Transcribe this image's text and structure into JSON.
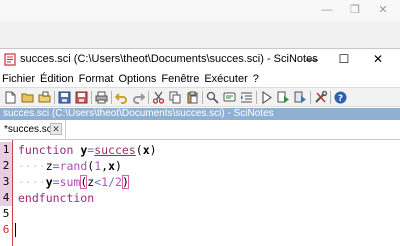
{
  "background_window": {
    "controls": [
      "—",
      "❐",
      "✕"
    ]
  },
  "window": {
    "title": "succes.sci (C:\\Users\\theot\\Documents\\succes.sci) - SciNotes",
    "controls": {
      "minimize": "—",
      "maximize": "☐",
      "close": "✕"
    }
  },
  "menu": [
    "Fichier",
    "Édition",
    "Format",
    "Options",
    "Fenêtre",
    "Exécuter",
    "?"
  ],
  "toolbar": {
    "icons": [
      "new-file-icon",
      "open-folder-icon",
      "open-file-icon",
      "save-icon",
      "save-as-icon",
      "print-icon",
      "undo-icon",
      "redo-icon",
      "cut-icon",
      "copy-icon",
      "paste-icon",
      "search-replace-icon",
      "comment-icon",
      "uncomment-icon",
      "indent-icon",
      "execute-icon",
      "execute-file-icon",
      "execute-selection-icon",
      "execute-until-cursor-icon",
      "clear-icon",
      "help-icon"
    ]
  },
  "path_bar": "succes.sci (C:\\Users\\theot\\Documents\\succes.sci) - SciNotes",
  "tab": {
    "label": "*succes.sci",
    "close": "✕"
  },
  "editor": {
    "line_numbers": [
      "1",
      "2",
      "3",
      "4",
      "5",
      "6"
    ],
    "lines": {
      "l1": {
        "kw": "function",
        "out": "y",
        "eq": "=",
        "name": "succes",
        "open": "(",
        "arg": "x",
        "close": ")"
      },
      "l2": {
        "indent": "····",
        "lhs": "z",
        "eq": "=",
        "fn": "rand",
        "open": "(",
        "a1": "1",
        "comma": ",",
        "a2": "x",
        "close": ")"
      },
      "l3": {
        "indent": "····",
        "lhs": "y",
        "eq": "=",
        "fn": "sum",
        "open": "(",
        "v": "z",
        "lt": "<",
        "n1": "1",
        "slash": "/",
        "n2": "2",
        "close": ")"
      },
      "l4": {
        "kw": "endfunction"
      }
    }
  },
  "colors": {
    "path_bar": "#8fb0d3",
    "keyword": "#a0297a",
    "current_line_marker": "#e9cde4"
  }
}
